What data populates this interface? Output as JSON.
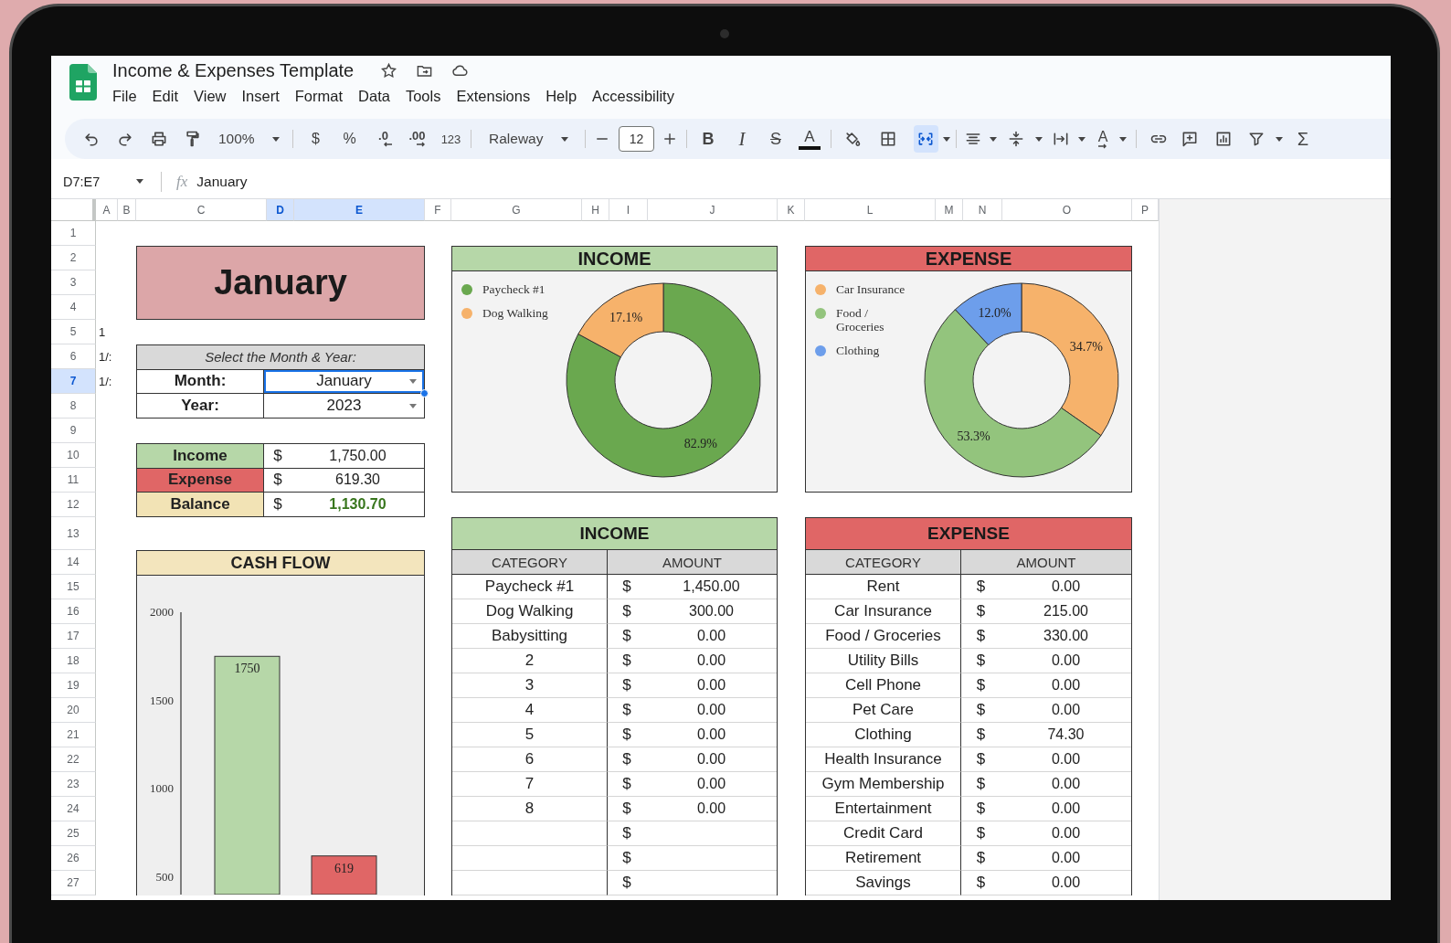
{
  "app": {
    "title": "Income & Expenses Template",
    "menu": [
      "File",
      "Edit",
      "View",
      "Insert",
      "Format",
      "Data",
      "Tools",
      "Extensions",
      "Help",
      "Accessibility"
    ]
  },
  "toolbar": {
    "zoom": "100%",
    "currency": "$",
    "percent": "%",
    "decrease_decimal": ".0",
    "increase_decimal": ".00",
    "number_format": "123",
    "font": "Raleway",
    "font_size": "12",
    "bold": {
      "label": "B",
      "on": false
    },
    "italic": {
      "label": "I",
      "on": false
    },
    "strikethrough": {
      "label": "S",
      "on": false
    },
    "text_color": "A",
    "merge_cells": {
      "on": true
    },
    "text_rotation": "A",
    "functions": "Σ"
  },
  "formula_bar": {
    "cell_range": "D7:E7",
    "fx": "fx",
    "value": "January"
  },
  "columns": [
    {
      "label": "A",
      "selected": false
    },
    {
      "label": "B",
      "selected": false
    },
    {
      "label": "C",
      "selected": false
    },
    {
      "label": "D",
      "selected": true
    },
    {
      "label": "E",
      "selected": true
    },
    {
      "label": "F",
      "selected": false
    },
    {
      "label": "G",
      "selected": false
    },
    {
      "label": "H",
      "selected": false
    },
    {
      "label": "I",
      "selected": false
    },
    {
      "label": "J",
      "selected": false
    },
    {
      "label": "K",
      "selected": false
    },
    {
      "label": "L",
      "selected": false
    },
    {
      "label": "M",
      "selected": false
    },
    {
      "label": "N",
      "selected": false
    },
    {
      "label": "O",
      "selected": false
    },
    {
      "label": "P",
      "selected": false
    }
  ],
  "rows": [
    {
      "label": "1",
      "selected": false
    },
    {
      "label": "2",
      "selected": false
    },
    {
      "label": "3",
      "selected": false
    },
    {
      "label": "4",
      "selected": false
    },
    {
      "label": "5",
      "selected": false
    },
    {
      "label": "6",
      "selected": false
    },
    {
      "label": "7",
      "selected": true
    },
    {
      "label": "8",
      "selected": false
    },
    {
      "label": "9",
      "selected": false
    },
    {
      "label": "10",
      "selected": false
    },
    {
      "label": "11",
      "selected": false
    },
    {
      "label": "12",
      "selected": false
    },
    {
      "label": "13",
      "selected": false
    },
    {
      "label": "14",
      "selected": false
    },
    {
      "label": "15",
      "selected": false
    },
    {
      "label": "16",
      "selected": false
    },
    {
      "label": "17",
      "selected": false
    },
    {
      "label": "18",
      "selected": false
    },
    {
      "label": "19",
      "selected": false
    },
    {
      "label": "20",
      "selected": false
    },
    {
      "label": "21",
      "selected": false
    },
    {
      "label": "22",
      "selected": false
    },
    {
      "label": "23",
      "selected": false
    },
    {
      "label": "24",
      "selected": false
    },
    {
      "label": "25",
      "selected": false
    },
    {
      "label": "26",
      "selected": false
    },
    {
      "label": "27",
      "selected": false
    }
  ],
  "sheet": {
    "month_banner": "January",
    "side_values": [
      "1",
      "1/:",
      "1/:"
    ],
    "selector": {
      "title": "Select the Month & Year:",
      "fields": [
        {
          "label": "Month:",
          "value": "January",
          "selected": true
        },
        {
          "label": "Year:",
          "value": "2023",
          "selected": false
        }
      ]
    },
    "summary": [
      {
        "label": "Income",
        "color": "#b6d7a8",
        "currency": "$",
        "amount": "1,750.00",
        "emphasis": false
      },
      {
        "label": "Expense",
        "color": "#e06666",
        "currency": "$",
        "amount": "619.30",
        "emphasis": false
      },
      {
        "label": "Balance",
        "color": "#f2e3b5",
        "currency": "$",
        "amount": "1,130.70",
        "emphasis": true
      }
    ],
    "cash_flow": {
      "chart_data": {
        "type": "bar",
        "title": "CASH FLOW",
        "categories": [
          null,
          null
        ],
        "values": [
          1750,
          619
        ],
        "colors": [
          "#b6d7a8",
          "#e06666"
        ],
        "data_labels": true,
        "yticks": [
          500,
          1000,
          1500,
          2000
        ],
        "ylim": [
          400,
          2000
        ]
      }
    },
    "income_chart": {
      "chart_data": {
        "type": "donut",
        "title": "INCOME",
        "categories": [
          "Paycheck #1",
          "Dog Walking"
        ],
        "values": [
          82.9,
          17.1
        ],
        "colors": [
          "#6aa84f",
          "#f6b26b"
        ],
        "value_labels": [
          "82.9%",
          "17.1%"
        ],
        "legend": "left"
      }
    },
    "income_table": {
      "title": "INCOME",
      "columns": [
        "CATEGORY",
        "AMOUNT"
      ],
      "rows": [
        {
          "category": "Paycheck #1",
          "currency": "$",
          "amount": "1,450.00"
        },
        {
          "category": "Dog Walking",
          "currency": "$",
          "amount": "300.00"
        },
        {
          "category": "Babysitting",
          "currency": "$",
          "amount": "0.00"
        },
        {
          "category": "2",
          "currency": "$",
          "amount": "0.00"
        },
        {
          "category": "3",
          "currency": "$",
          "amount": "0.00"
        },
        {
          "category": "4",
          "currency": "$",
          "amount": "0.00"
        },
        {
          "category": "5",
          "currency": "$",
          "amount": "0.00"
        },
        {
          "category": "6",
          "currency": "$",
          "amount": "0.00"
        },
        {
          "category": "7",
          "currency": "$",
          "amount": "0.00"
        },
        {
          "category": "8",
          "currency": "$",
          "amount": "0.00"
        },
        {
          "currency": "$"
        },
        {
          "currency": "$"
        },
        {
          "currency": "$"
        }
      ]
    },
    "expense_chart": {
      "chart_data": {
        "type": "donut",
        "title": "EXPENSE",
        "categories": [
          "Car Insurance",
          "Food / Groceries",
          "Clothing"
        ],
        "values": [
          34.7,
          53.3,
          12.0
        ],
        "colors": [
          "#f6b26b",
          "#93c47d",
          "#6d9eeb"
        ],
        "value_labels": [
          "34.7%",
          "53.3%",
          "12.0%"
        ],
        "legend": "left"
      }
    },
    "expense_table": {
      "title": "EXPENSE",
      "columns": [
        "CATEGORY",
        "AMOUNT"
      ],
      "rows": [
        {
          "category": "Rent",
          "currency": "$",
          "amount": "0.00"
        },
        {
          "category": "Car Insurance",
          "currency": "$",
          "amount": "215.00"
        },
        {
          "category": "Food / Groceries",
          "currency": "$",
          "amount": "330.00"
        },
        {
          "category": "Utility Bills",
          "currency": "$",
          "amount": "0.00"
        },
        {
          "category": "Cell Phone",
          "currency": "$",
          "amount": "0.00"
        },
        {
          "category": "Pet Care",
          "currency": "$",
          "amount": "0.00"
        },
        {
          "category": "Clothing",
          "currency": "$",
          "amount": "74.30"
        },
        {
          "category": "Health Insurance",
          "currency": "$",
          "amount": "0.00"
        },
        {
          "category": "Gym Membership",
          "currency": "$",
          "amount": "0.00"
        },
        {
          "category": "Entertainment",
          "currency": "$",
          "amount": "0.00"
        },
        {
          "category": "Credit Card",
          "currency": "$",
          "amount": "0.00"
        },
        {
          "category": "Retirement",
          "currency": "$",
          "amount": "0.00"
        },
        {
          "category": "Savings",
          "currency": "$",
          "amount": "0.00"
        }
      ]
    }
  }
}
